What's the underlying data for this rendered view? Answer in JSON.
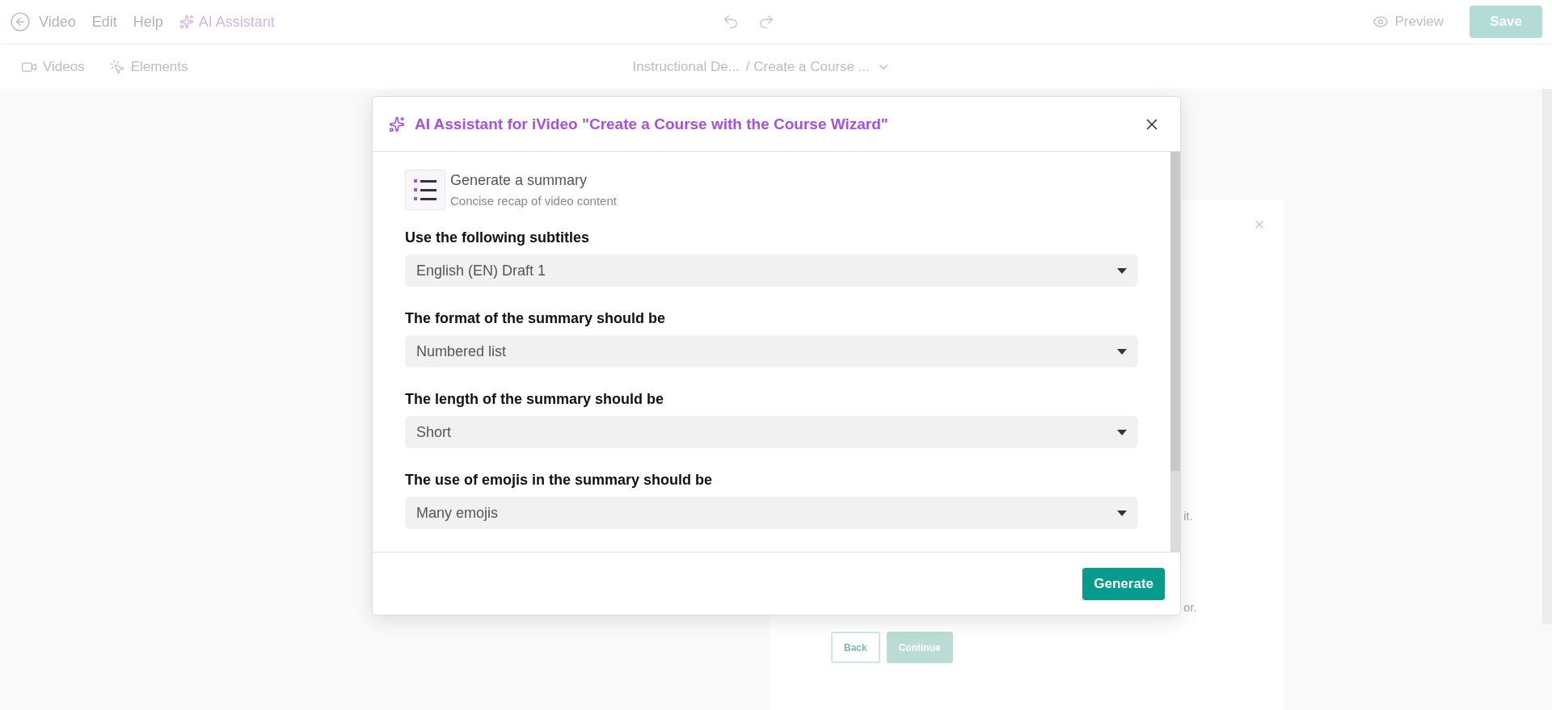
{
  "topbar": {
    "menu": [
      {
        "label": "Video",
        "kind": "back"
      },
      {
        "label": "Edit",
        "kind": "plain"
      },
      {
        "label": "Help",
        "kind": "plain"
      },
      {
        "label": "AI Assistant",
        "kind": "ai"
      }
    ],
    "preview": "Preview",
    "save": "Save"
  },
  "toolbar": {
    "tabs": [
      {
        "label": "Videos",
        "kind": "video"
      },
      {
        "label": "Elements",
        "kind": "elements"
      }
    ],
    "breadcrumb": [
      "Instructional De...",
      "/ Create a Course ..."
    ]
  },
  "background": {
    "fragments": [
      "it.",
      "or."
    ],
    "buttons": [
      {
        "label": "Back",
        "kind": "outline"
      },
      {
        "label": "Continue",
        "kind": "filled"
      }
    ]
  },
  "dialog": {
    "title": "AI Assistant for iVideo \"Create a Course with the Course Wizard\"",
    "task": {
      "title": "Generate a summary",
      "subtitle": "Concise recap of video content"
    },
    "fields": [
      {
        "label": "Use the following subtitles",
        "value": "English (EN) Draft 1"
      },
      {
        "label": "The format of the summary should be",
        "value": "Numbered list"
      },
      {
        "label": "The length of the summary should be",
        "value": "Short"
      },
      {
        "label": "The use of emojis in the summary should be",
        "value": "Many emojis"
      }
    ],
    "button": "Generate"
  }
}
